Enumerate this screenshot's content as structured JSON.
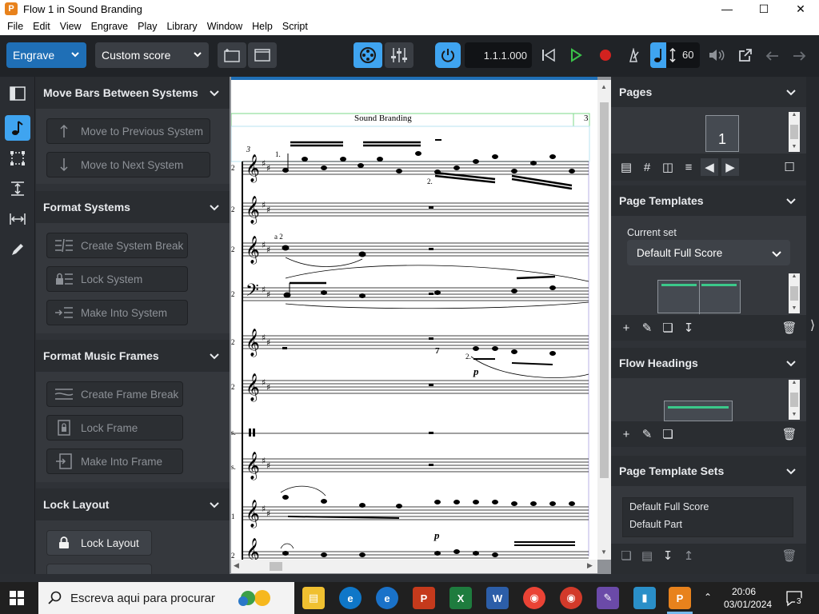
{
  "window": {
    "title": "Flow 1 in Sound Branding",
    "app_icon": "P"
  },
  "menu": [
    "File",
    "Edit",
    "View",
    "Engrave",
    "Play",
    "Library",
    "Window",
    "Help",
    "Script"
  ],
  "toolbar": {
    "mode": "Engrave",
    "layout": "Custom score",
    "position": "1.1.1.000",
    "tempo": "60"
  },
  "left_panel": {
    "sections": [
      {
        "title": "Move Bars Between Systems",
        "buttons": [
          "Move to Previous System",
          "Move to Next System"
        ]
      },
      {
        "title": "Format Systems",
        "buttons": [
          "Create System Break",
          "Lock System",
          "Make Into System"
        ]
      },
      {
        "title": "Format Music Frames",
        "buttons": [
          "Create Frame Break",
          "Lock Frame",
          "Make Into Frame"
        ]
      },
      {
        "title": "Lock Layout",
        "buttons": [
          "Lock Layout"
        ]
      }
    ]
  },
  "score": {
    "header_title": "Sound Branding",
    "page_number": "3",
    "bar_number": "3",
    "markings": {
      "ending1": "1.",
      "ending2": "2.",
      "a2": "a 2",
      "ending2b": "2.",
      "dynamic1": "p",
      "dynamic2": "p",
      "rest7": "7"
    },
    "staff_labels": [
      "2",
      "2",
      "2",
      "2",
      "2",
      "2",
      "s.",
      "s.",
      "1",
      "2"
    ]
  },
  "right_panel": {
    "pages_title": "Pages",
    "page_thumb_number": "1",
    "page_templates_title": "Page Templates",
    "current_set_label": "Current set",
    "current_set_value": "Default Full Score",
    "flow_headings_title": "Flow Headings",
    "page_template_sets_title": "Page Template Sets",
    "template_sets": [
      "Default Full Score",
      "Default Part"
    ]
  },
  "taskbar": {
    "search_placeholder": "Escreva aqui para procurar",
    "time": "20:06",
    "date": "03/01/2024",
    "notifications": "3"
  }
}
